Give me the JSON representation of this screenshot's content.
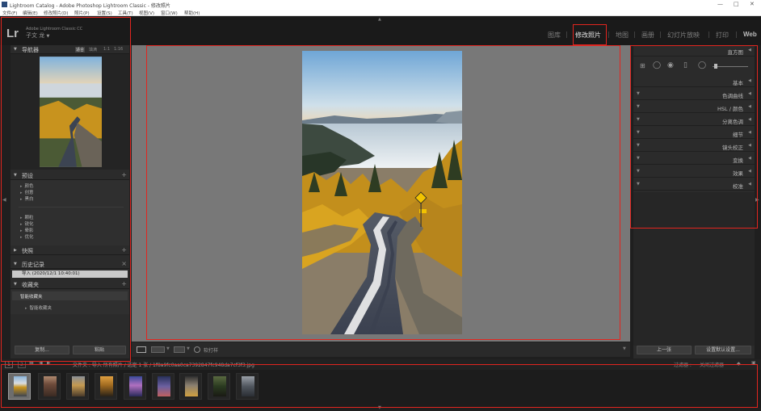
{
  "window": {
    "title": "Lightroom Catalog - Adobe Photoshop Lightroom Classic - 修改照片"
  },
  "menu": [
    "文件(F)",
    "编辑(E)",
    "修改照片(D)",
    "照片(P)",
    "设置(S)",
    "工具(T)",
    "视图(V)",
    "窗口(W)",
    "帮助(H)"
  ],
  "identity": {
    "logo": "Lr",
    "product": "Adobe Lightroom Classic CC",
    "user": "子文 龙"
  },
  "modules": [
    "图库",
    "修改照片",
    "地图",
    "画册",
    "幻灯片放映",
    "打印",
    "Web"
  ],
  "active_module": "修改照片",
  "left_panel": {
    "navigator": {
      "title": "导航器",
      "zoom": [
        "适合",
        "填满",
        "1:1",
        "1:16"
      ]
    },
    "presets": {
      "title": "预设",
      "items_top": [
        "颜色",
        "创意",
        "黑白"
      ],
      "items_bottom": [
        "颗粒",
        "锐化",
        "晕影",
        "优化"
      ]
    },
    "snapshots": {
      "title": "快照"
    },
    "history": {
      "title": "历史记录",
      "entry": "导入 (2020/12/1 10:40:01)"
    },
    "collections": {
      "title": "收藏夹",
      "items": [
        "智能收藏夹",
        "智能收藏夹"
      ]
    },
    "buttons": {
      "copy": "复制...",
      "paste": "粘贴"
    }
  },
  "right_panel": {
    "histogram": "直方图",
    "panels": [
      "基本",
      "色调曲线",
      "HSL / 颜色",
      "分离色调",
      "细节",
      "镜头校正",
      "变换",
      "效果",
      "校准"
    ],
    "buttons": {
      "previous": "上一张",
      "reset": "设置默认设置..."
    }
  },
  "toolbar": {
    "softproof": "软打样"
  },
  "filmstrip": {
    "pages": [
      "1",
      "2"
    ],
    "path": "文件夹 : 导入  所有照片 / 选定 1 张 / 1f8a9fc0aa0ca7392847fc948da7cf3f3.jpg",
    "filter_label": "过滤器 :",
    "filter_value": "关闭过滤器",
    "thumbnail_count": 9
  },
  "colors": {
    "highlight": "#e2251f",
    "bg": "#1f1f1f",
    "panel": "#2b2b2b"
  }
}
